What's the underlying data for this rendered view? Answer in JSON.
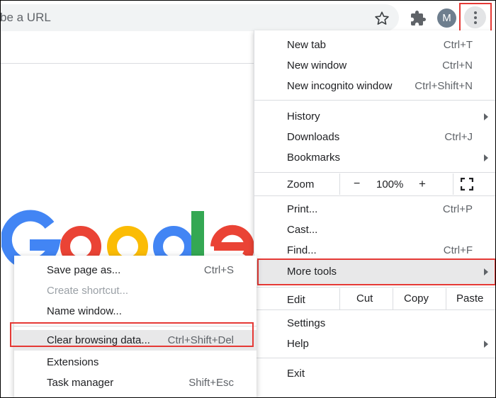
{
  "toolbar": {
    "omnibox_placeholder": "be a URL",
    "avatar_initial": "M"
  },
  "main_menu": {
    "items": {
      "new_tab": {
        "label": "New tab",
        "shortcut": "Ctrl+T"
      },
      "new_window": {
        "label": "New window",
        "shortcut": "Ctrl+N"
      },
      "new_incognito": {
        "label": "New incognito window",
        "shortcut": "Ctrl+Shift+N"
      },
      "history": {
        "label": "History"
      },
      "downloads": {
        "label": "Downloads",
        "shortcut": "Ctrl+J"
      },
      "bookmarks": {
        "label": "Bookmarks"
      },
      "print": {
        "label": "Print...",
        "shortcut": "Ctrl+P"
      },
      "cast": {
        "label": "Cast..."
      },
      "find": {
        "label": "Find...",
        "shortcut": "Ctrl+F"
      },
      "more_tools": {
        "label": "More tools"
      },
      "settings": {
        "label": "Settings"
      },
      "help": {
        "label": "Help"
      },
      "exit": {
        "label": "Exit"
      }
    },
    "zoom": {
      "label": "Zoom",
      "minus": "−",
      "value": "100%",
      "plus": "+"
    },
    "edit": {
      "label": "Edit",
      "cut": "Cut",
      "copy": "Copy",
      "paste": "Paste"
    }
  },
  "more_tools_submenu": {
    "save_page": {
      "label": "Save page as...",
      "shortcut": "Ctrl+S"
    },
    "create_shortcut": {
      "label": "Create shortcut..."
    },
    "name_window": {
      "label": "Name window..."
    },
    "clear_browsing": {
      "label": "Clear browsing data...",
      "shortcut": "Ctrl+Shift+Del"
    },
    "extensions": {
      "label": "Extensions"
    },
    "task_manager": {
      "label": "Task manager",
      "shortcut": "Shift+Esc"
    }
  },
  "colors": {
    "highlight": "#e53935",
    "hover": "#e8e8e9",
    "google_blue": "#4285f4",
    "google_red": "#ea4335",
    "google_yellow": "#fbbc05",
    "google_green": "#34a853"
  },
  "icons": [
    "star-icon",
    "puzzle-icon",
    "kebab-menu-icon",
    "fullscreen-icon",
    "chevron-right-icon"
  ]
}
